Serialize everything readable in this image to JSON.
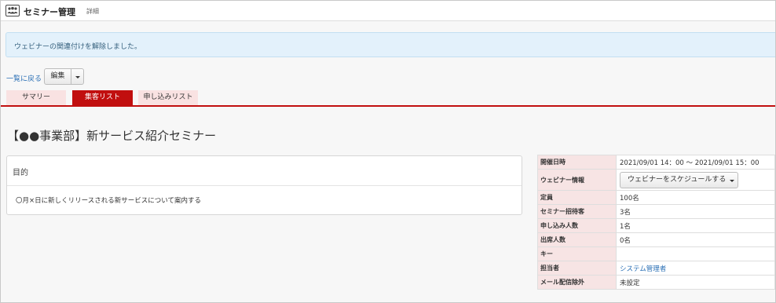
{
  "header": {
    "title": "セミナー管理",
    "subtitle": "詳細",
    "icon": "seminar-people-icon"
  },
  "alert": {
    "message": "ウェビナーの関連付けを解除しました。"
  },
  "toolbar": {
    "back_label": "一覧に戻る",
    "edit_label": "編集"
  },
  "tabs": [
    {
      "label": "サマリー",
      "active": false
    },
    {
      "label": "集客リスト",
      "active": true
    },
    {
      "label": "申し込みリスト",
      "active": false
    }
  ],
  "page": {
    "title": "【●●事業部】新サービス紹介セミナー"
  },
  "purpose": {
    "heading": "目的",
    "body": "〇月×日に新しくリリースされる新サービスについて案内する"
  },
  "info": {
    "rows": [
      {
        "label": "開催日時",
        "value": "2021/09/01 14：00 ～ 2021/09/01 15：00"
      },
      {
        "label": "ウェビナー情報",
        "value": "ウェビナーをスケジュールする"
      },
      {
        "label": "定員",
        "value": "100名"
      },
      {
        "label": "セミナー招待客",
        "value": "3名"
      },
      {
        "label": "申し込み人数",
        "value": "1名"
      },
      {
        "label": "出席人数",
        "value": "0名"
      },
      {
        "label": "キー",
        "value": ""
      },
      {
        "label": "担当者",
        "value": "システム管理者"
      },
      {
        "label": "メール配信除外",
        "value": "未設定"
      }
    ]
  },
  "colors": {
    "accent": "#c10f0f",
    "tab_inactive": "#f9e2e2",
    "alert_bg": "#e3f1fb",
    "link": "#2a6fb5",
    "label_bg": "#f7e4e4"
  }
}
